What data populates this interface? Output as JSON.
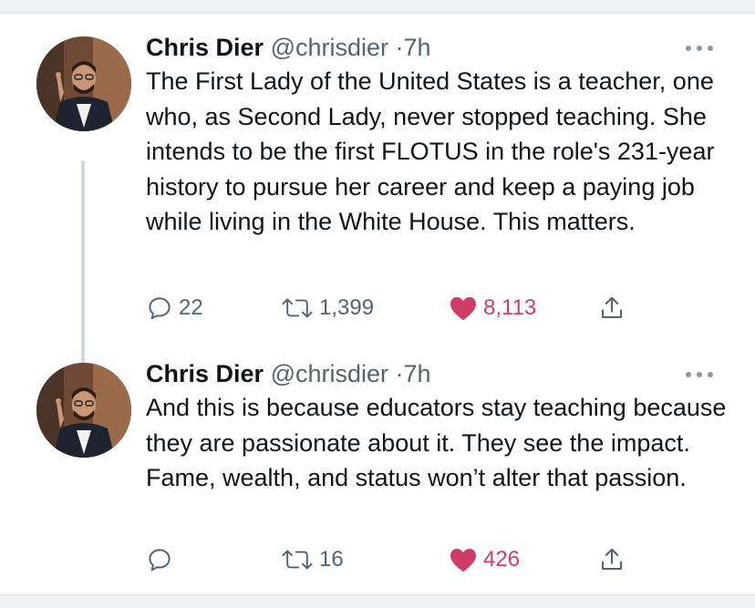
{
  "tweets": [
    {
      "author": {
        "name": "Chris Dier",
        "handle": "@chrisdier",
        "separator": "·",
        "time": "7h"
      },
      "text": "The First Lady of the United States is a teacher, one who, as Second Lady, never stopped teaching. She intends to be the first FLOTUS in the role's 231-year history to pursue her career and keep a paying job while living in the White House. This matters.",
      "stats": {
        "replies": "22",
        "retweets": "1,399",
        "likes": "8,113"
      },
      "liked": true
    },
    {
      "author": {
        "name": "Chris Dier",
        "handle": "@chrisdier",
        "separator": "·",
        "time": "7h"
      },
      "text": "And this is because educators stay teaching because they are passionate about it. They see the impact. Fame, wealth, and status won’t alter that passion.",
      "stats": {
        "replies": "",
        "retweets": "16",
        "likes": "426"
      },
      "liked": true
    }
  ],
  "icons": {
    "reply": "speech-bubble-icon",
    "retweet": "retweet-arrows-icon",
    "like": "heart-icon",
    "share": "share-upload-icon",
    "more": "more-horizontal-icon"
  },
  "colors": {
    "text": "#0f1419",
    "secondary": "#536471",
    "like": "#cf3c66",
    "thread_line": "#cfd9de"
  }
}
